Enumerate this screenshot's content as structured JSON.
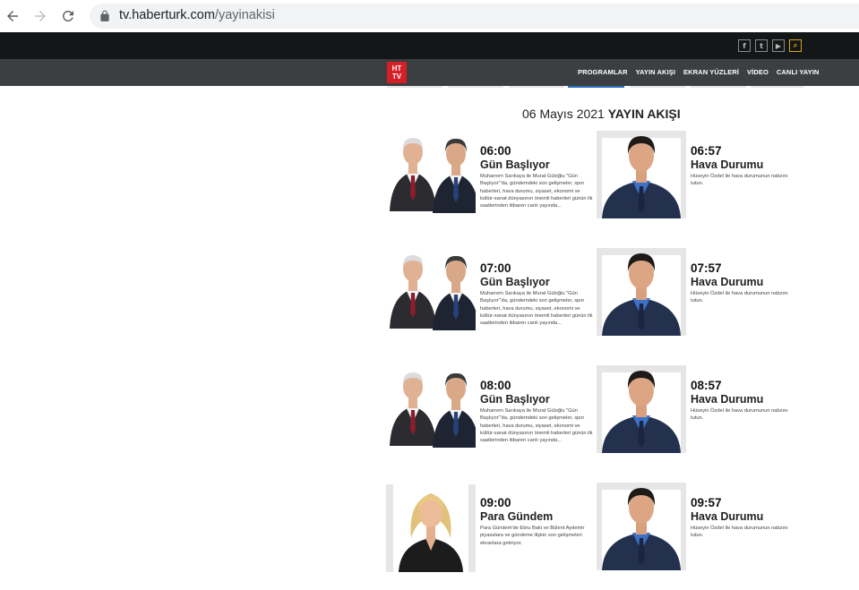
{
  "browser": {
    "url_host": "tv.haberturk.com",
    "url_path": "/yayinakisi"
  },
  "topbar": {
    "social": [
      {
        "icon": "facebook-icon",
        "glyph": "f"
      },
      {
        "icon": "twitter-icon",
        "glyph": "t"
      },
      {
        "icon": "youtube-icon",
        "glyph": "▶"
      },
      {
        "icon": "search-icon",
        "glyph": "⌕"
      }
    ]
  },
  "nav": {
    "logo_top": "HT",
    "logo_bottom": "TV",
    "items": [
      "PROGRAMLAR",
      "YAYIN AKIŞI",
      "EKRAN YÜZLERİ",
      "VİDEO",
      "CANLI YAYIN"
    ]
  },
  "schedule": {
    "date": "06 Mayıs 2021",
    "title": "YAYIN AKIŞI",
    "programs": [
      {
        "time": "06:00",
        "name": "Gün Başlıyor",
        "desc": "Muharrem Sarıkaya ile Murat Güloğlu \"Gün Başlıyor\"'da, gündemdeki son gelişmeler, spor haberleri, hava durumu, siyaset, ekonomi ve kültür-sanat dünyasının önemli haberleri günün ilk saatlerinden itibaren canlı yayında...",
        "thumb": "duo"
      },
      {
        "time": "06:57",
        "name": "Hava Durumu",
        "desc": "Hüseyin Özdel ile hava durumunun nabzını tutun.",
        "thumb": "weather"
      },
      {
        "time": "07:00",
        "name": "Gün Başlıyor",
        "desc": "Muharrem Sarıkaya ile Murat Güloğlu \"Gün Başlıyor\"'da, gündemdeki son gelişmeler, spor haberleri, hava durumu, siyaset, ekonomi ve kültür-sanat dünyasının önemli haberleri günün ilk saatlerinden itibaren canlı yayında...",
        "thumb": "duo"
      },
      {
        "time": "07:57",
        "name": "Hava Durumu",
        "desc": "Hüseyin Özdel ile hava durumunun nabzını tutun.",
        "thumb": "weather"
      },
      {
        "time": "08:00",
        "name": "Gün Başlıyor",
        "desc": "Muharrem Sarıkaya ile Murat Güloğlu \"Gün Başlıyor\"'da, gündemdeki son gelişmeler, spor haberleri, hava durumu, siyaset, ekonomi ve kültür-sanat dünyasının önemli haberleri günün ilk saatlerinden itibaren canlı yayında...",
        "thumb": "duo"
      },
      {
        "time": "08:57",
        "name": "Hava Durumu",
        "desc": "Hüseyin Özdel ile hava durumunun nabzını tutun.",
        "thumb": "weather"
      },
      {
        "time": "09:00",
        "name": "Para Gündem",
        "desc": "Para Gündem'de Ebru Baki ve Bülent Aydemir piyasalara ve gündeme ilişkin son gelişmeleri ekranlara getiriyor.",
        "thumb": "woman"
      },
      {
        "time": "09:57",
        "name": "Hava Durumu",
        "desc": "Hüseyin Özdel ile hava durumunun nabzını tutun.",
        "thumb": "weather"
      }
    ]
  },
  "colors": {
    "topbar": "#141718",
    "navbar": "#3c3f41",
    "logo": "#d41f26",
    "active_tab": "#2a6ebd",
    "search_accent": "#d9a51a"
  }
}
